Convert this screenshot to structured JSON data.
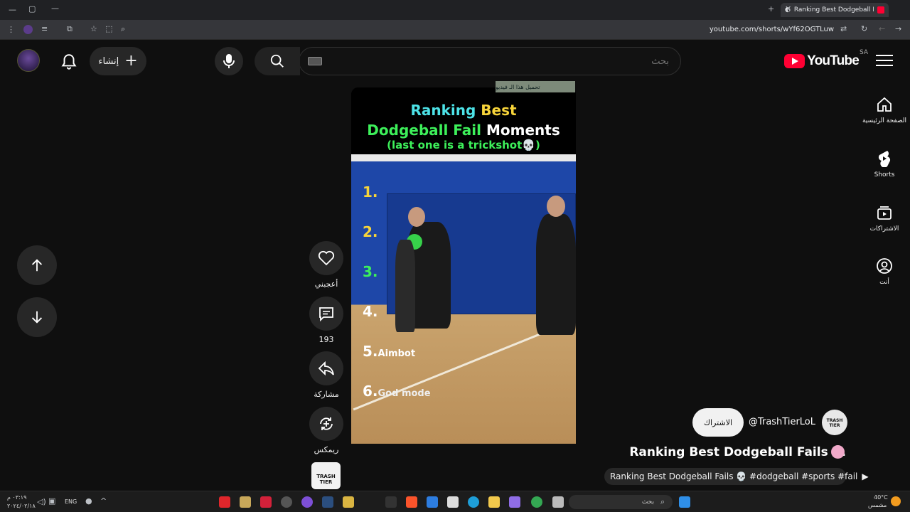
{
  "browser": {
    "tab_title": "Ranking Best Dodgeball Fa",
    "url": "youtube.com/shorts/wYf62OGTLuw"
  },
  "header": {
    "logo_text": "YouTube",
    "country_code": "SA",
    "search_placeholder": "بحث",
    "create_label": "إنشاء"
  },
  "guide": {
    "items": [
      {
        "label": "الصفحة الرئيسية",
        "icon": "home-icon"
      },
      {
        "label": "Shorts",
        "icon": "shorts-icon"
      },
      {
        "label": "الاشتراكات",
        "icon": "subscriptions-icon"
      },
      {
        "label": "أنت",
        "icon": "you-icon"
      }
    ]
  },
  "video": {
    "overlay_ad": "تحميل هذا الـ فيديو",
    "title_line1_a": "Ranking ",
    "title_line1_b": "Best",
    "title_line2_a": "Dodgeball Fail ",
    "title_line2_b": "Moments",
    "title_line3": "(last one is a trickshot💀)",
    "ranks": [
      {
        "num": "1.",
        "label": "",
        "color": "#f7d43a"
      },
      {
        "num": "2.",
        "label": "",
        "color": "#f7d43a"
      },
      {
        "num": "3.",
        "label": "",
        "color": "#3df05a"
      },
      {
        "num": "4.",
        "label": "",
        "color": "#ffffff"
      },
      {
        "num": "5.",
        "label": "Aimbot",
        "color": "#ffffff"
      },
      {
        "num": "6.",
        "label": "God mode",
        "color": "#ffffff"
      }
    ]
  },
  "actions": {
    "like_label": "أعجبني",
    "comments_count": "193",
    "share_label": "مشاركة",
    "remix_label": "ريمكس",
    "channel_thumb_text": "TRASH TIER"
  },
  "meta": {
    "channel_handle": "@TrashTierLoL",
    "subscribe_label": "الاشتراك",
    "title": "Ranking Best Dodgeball Fails ...",
    "description": "Ranking Best Dodgeball Fails 💀 #dodgeball #sports #fail"
  },
  "taskbar": {
    "search_placeholder": "بحث",
    "lang": "ENG",
    "time": "٠٣:١٩ م",
    "date": "٢٠٢٤/٠٢/١٨",
    "weather_temp": "40°C",
    "weather_desc": "مشمس"
  },
  "colors": {
    "accent_red": "#ff0033",
    "title_cyan": "#4de3e8",
    "title_yellow": "#f7d43a",
    "title_green": "#3df05a"
  }
}
